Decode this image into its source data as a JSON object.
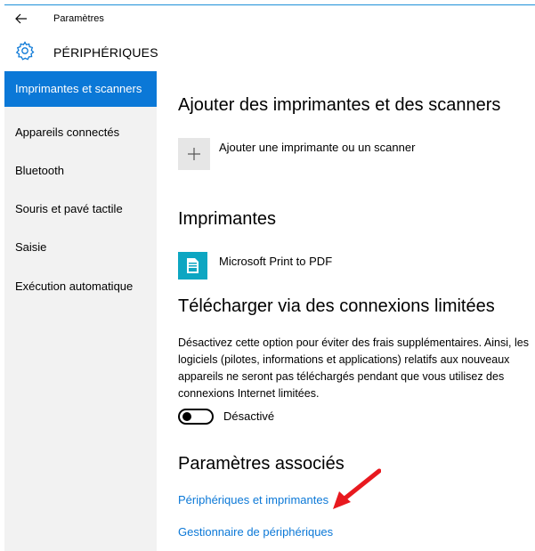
{
  "window": {
    "title": "Paramètres"
  },
  "header": {
    "title": "PÉRIPHÉRIQUES"
  },
  "sidebar": {
    "items": [
      {
        "label": "Imprimantes et scanners",
        "selected": true
      },
      {
        "label": "Appareils connectés",
        "selected": false
      },
      {
        "label": "Bluetooth",
        "selected": false
      },
      {
        "label": "Souris et pavé tactile",
        "selected": false
      },
      {
        "label": "Saisie",
        "selected": false
      },
      {
        "label": "Exécution automatique",
        "selected": false
      }
    ]
  },
  "main": {
    "add_section": {
      "title": "Ajouter des imprimantes et des scanners",
      "add_label": "Ajouter une imprimante ou un scanner"
    },
    "printers_section": {
      "title": "Imprimantes",
      "printers": [
        "Microsoft Print to PDF"
      ]
    },
    "metered_section": {
      "title": "Télécharger via des connexions limitées",
      "description": "Désactivez cette option pour éviter des frais supplémentaires. Ainsi, les logiciels (pilotes, informations et applications) relatifs aux nouveaux appareils ne seront pas téléchargés pendant que vous utilisez des connexions Internet limitées.",
      "toggle_state": "Désactivé",
      "toggle_on": false
    },
    "related_section": {
      "title": "Paramètres associés",
      "links": [
        "Périphériques et imprimantes",
        "Gestionnaire de périphériques"
      ]
    }
  },
  "colors": {
    "accent": "#0b78d7",
    "sidebar_bg": "#f2f2f2",
    "printer_icon_bg": "#0da6c2",
    "annotation_arrow": "#e8191f"
  },
  "icons": {
    "back": "back-arrow-icon",
    "settings": "gear-icon",
    "add": "plus-icon",
    "printer": "pdf-printer-icon",
    "annotation": "red-arrow-icon"
  }
}
